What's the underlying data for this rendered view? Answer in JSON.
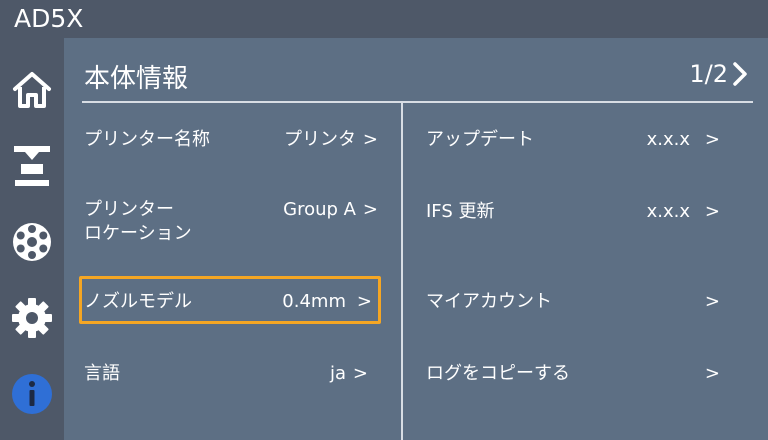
{
  "app": {
    "title": "AD5X"
  },
  "sidebar": {
    "items": [
      {
        "name": "home",
        "icon": "home-icon"
      },
      {
        "name": "print",
        "icon": "printer-icon"
      },
      {
        "name": "filament",
        "icon": "spool-icon"
      },
      {
        "name": "settings",
        "icon": "gear-icon"
      },
      {
        "name": "info",
        "icon": "info-icon",
        "active": true
      }
    ]
  },
  "header": {
    "title": "本体情報",
    "page": "1/2"
  },
  "left_rows": [
    {
      "label": "プリンター名称",
      "value": "プリンタ",
      "arrow": ">"
    },
    {
      "label_line1": "プリンター",
      "label_line2": "ロケーション",
      "value": "Group A",
      "arrow": ">"
    },
    {
      "label": "ノズルモデル",
      "value": "0.4mm",
      "arrow": ">"
    },
    {
      "label": "言語",
      "value": "ja",
      "arrow": ">"
    }
  ],
  "right_rows": [
    {
      "label": "アップデート",
      "value": "x.x.x",
      "arrow": ">"
    },
    {
      "label": "IFS 更新",
      "value": "x.x.x",
      "arrow": ">"
    },
    {
      "label": "マイアカウント",
      "value": "",
      "arrow": ">"
    },
    {
      "label": "ログをコピーする",
      "value": "",
      "arrow": ">"
    }
  ],
  "colors": {
    "highlight": "#f5a623",
    "info_active": "#2f6fd6",
    "bar": "#4e5868",
    "panel": "#5d6f84"
  }
}
